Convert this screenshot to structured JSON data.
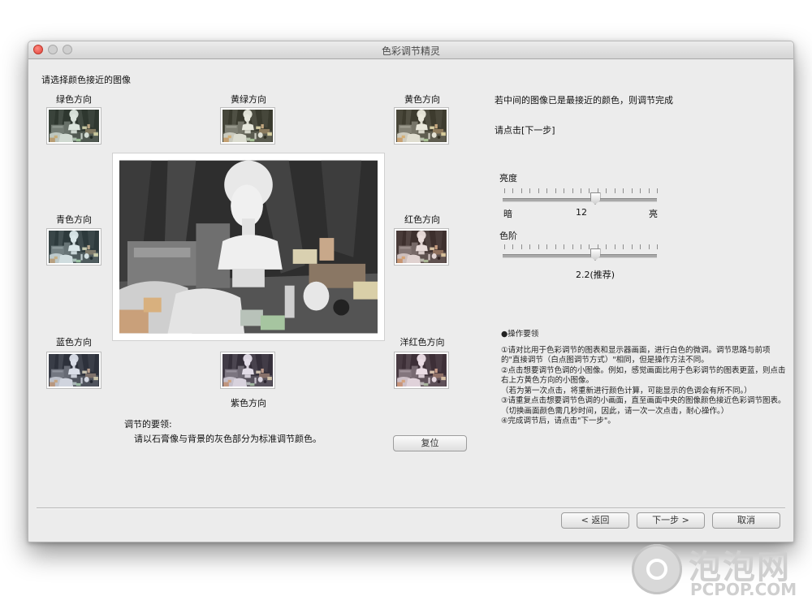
{
  "window": {
    "title": "色彩调节精灵"
  },
  "main": {
    "heading": "请选择颜色接近的图像",
    "directions": {
      "green": "绿色方向",
      "yellow_green": "黄绿方向",
      "yellow": "黄色方向",
      "cyan": "青色方向",
      "red": "红色方向",
      "blue": "蓝色方向",
      "purple": "紫色方向",
      "magenta": "洋红色方向"
    },
    "tips_title": "调节的要领:",
    "tips_text": "请以石膏像与背景的灰色部分为标准调节颜色。",
    "reset_label": "复位"
  },
  "right": {
    "info1": "若中间的图像已是最接近的颜色，则调节完成",
    "info2": "请点击[下一步]",
    "brightness": {
      "label": "亮度",
      "min_label": "暗",
      "max_label": "亮",
      "value": "12",
      "level": 0.6
    },
    "gamma": {
      "label": "色阶",
      "value": "2.2(推荐)",
      "level": 0.6
    },
    "notes_title": "●操作要领",
    "notes": [
      "①请对比用于色彩调节的图表和显示器画面，进行白色的微调。调节思路与前项",
      "的\"直接调节（白点图调节方式）\"相同，但是操作方法不同。",
      "②点击想要调节色调的小图像。例如，感觉画面比用于色彩调节的图表更蓝，则点击",
      "右上方黄色方向的小图像。",
      "（若为第一次点击，将重新进行颜色计算，可能显示的色调会有所不同。）",
      "③请重复点击想要调节色调的小画面，直至画面中央的图像颜色接近色彩调节图表。",
      "（切换画面颜色需几秒时间，因此，请一次一次点击，耐心操作。）",
      "④完成调节后，请点击\"下一步\"。"
    ]
  },
  "footer": {
    "back_label": "< 返回",
    "next_label": "下一步 >",
    "cancel_label": "取消"
  },
  "watermark": {
    "big": "泡泡网",
    "small": "PCPOP.COM"
  },
  "colors": {
    "window_bg": "#ececec",
    "close_red": "#e0443e"
  }
}
